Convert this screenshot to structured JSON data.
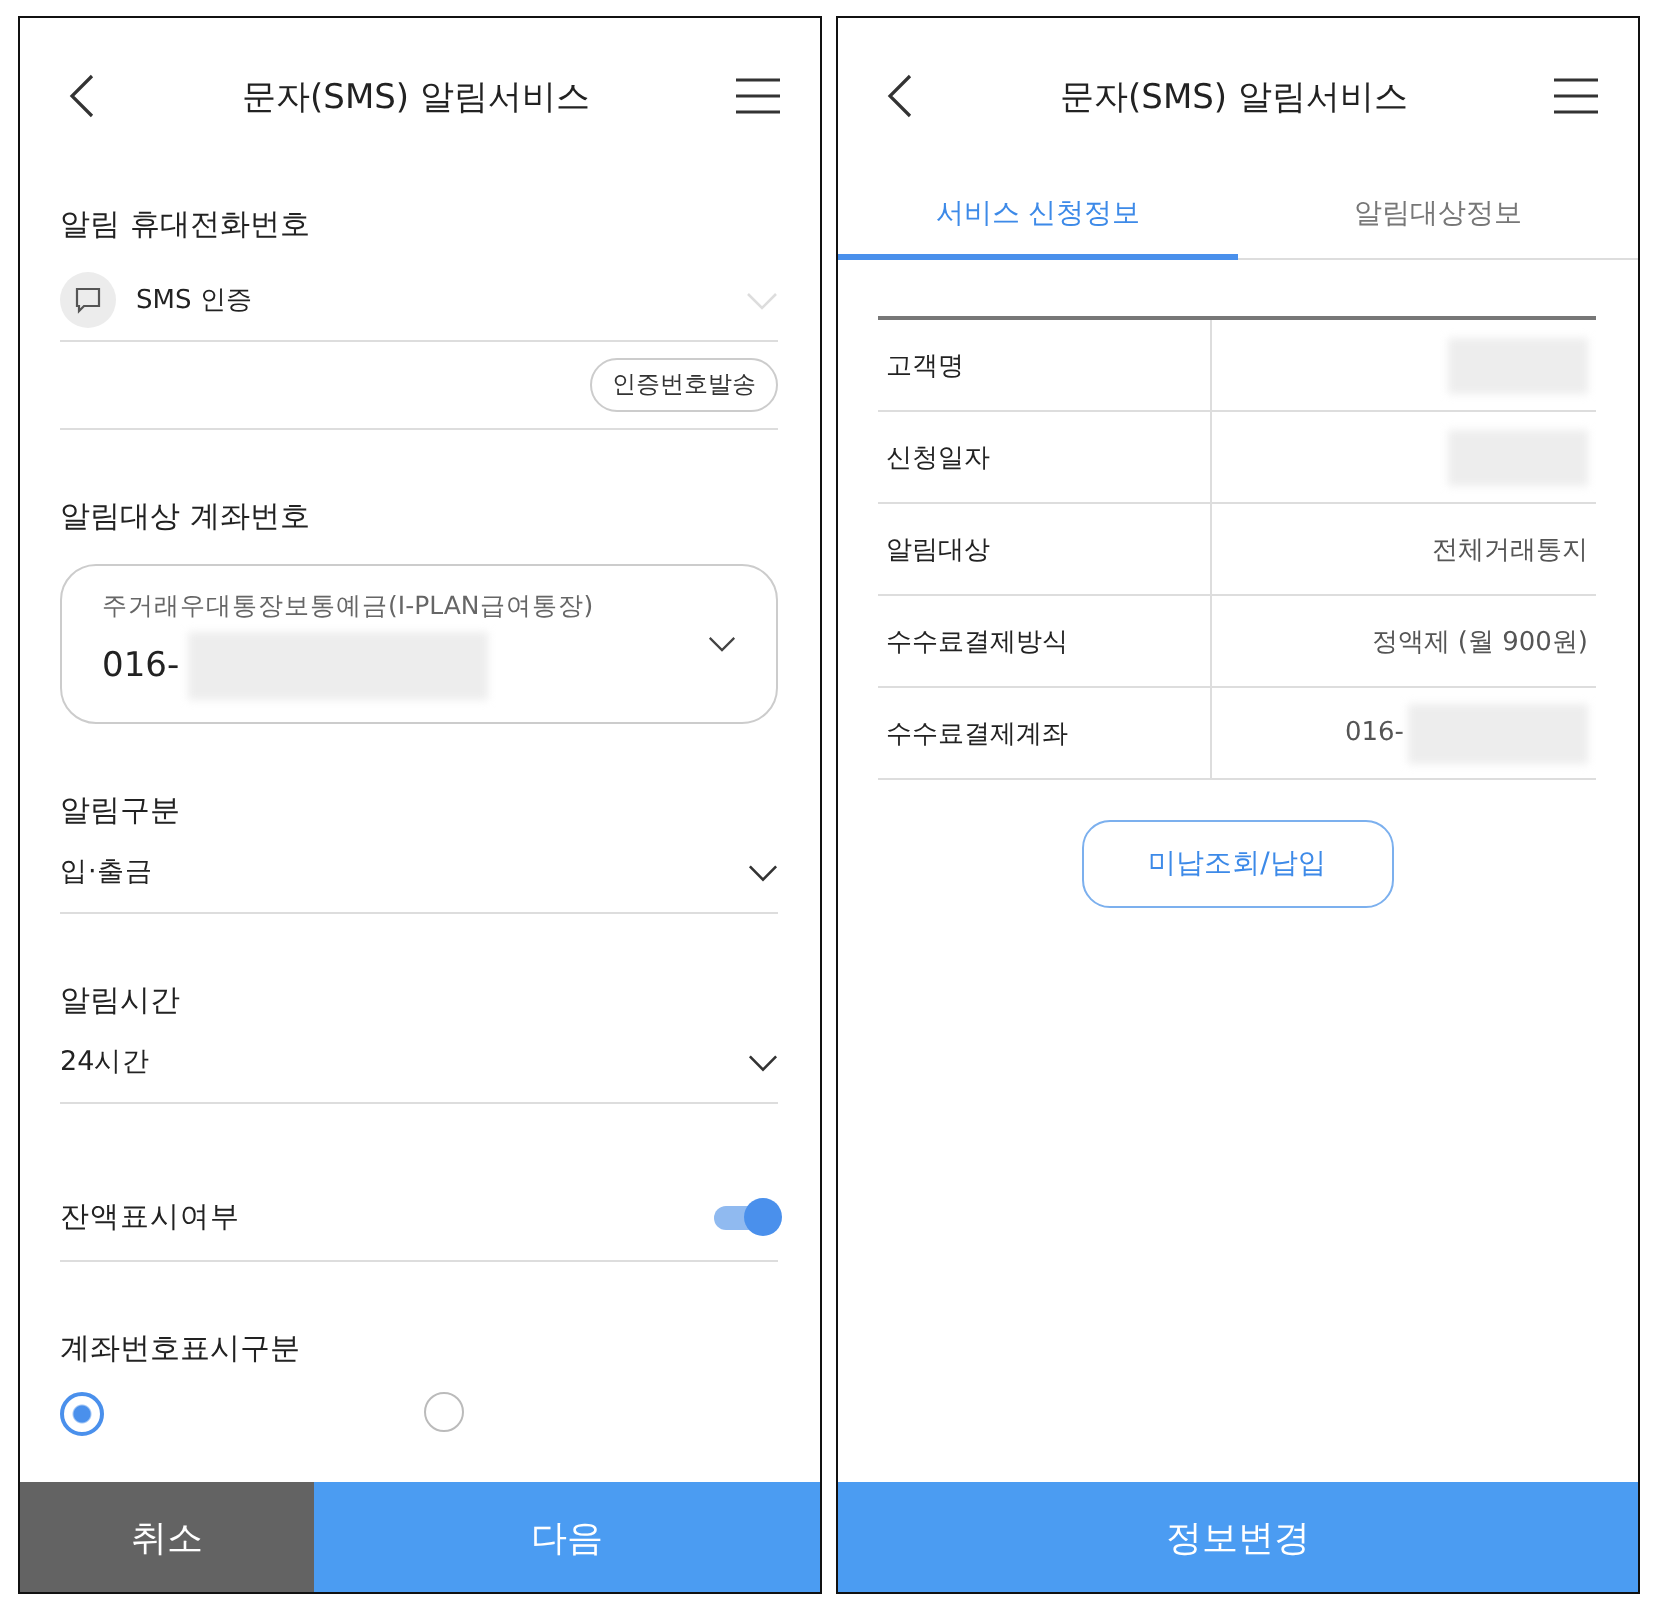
{
  "left_screen": {
    "header": {
      "title": "문자(SMS) 알림서비스"
    },
    "phone_section": {
      "label": "알림 휴대전화번호",
      "method": "SMS 인증",
      "send_button": "인증번호발송"
    },
    "account_section": {
      "label": "알림대상 계좌번호",
      "account_name": "주거래우대통장보통예금(I-PLAN급여통장)",
      "account_number": "016-",
      "masked": true
    },
    "selects": [
      {
        "label": "알림구분",
        "value": "입·출금"
      },
      {
        "label": "알림시간",
        "value": "24시간"
      }
    ],
    "balance_toggle": {
      "label": "잔액표시여부",
      "on": true
    },
    "display_section": {
      "label": "계좌번호표시구분",
      "options": [
        {
          "selected": true
        },
        {
          "selected": false
        }
      ]
    },
    "footer_buttons": [
      {
        "label": "취소",
        "kind": "secondary"
      },
      {
        "label": "다음",
        "kind": "primary"
      }
    ]
  },
  "right_screen": {
    "header": {
      "title": "문자(SMS) 알림서비스"
    },
    "tabs": [
      {
        "label": "서비스 신청정보",
        "selected": true
      },
      {
        "label": "알림대상정보",
        "selected": false
      }
    ],
    "table_rows": [
      {
        "label": "고객명",
        "masked": true
      },
      {
        "label": "신청일자",
        "masked": true
      },
      {
        "label": "알림대상",
        "value": "전체거래통지",
        "masked": false
      },
      {
        "label": "수수료결제방식",
        "value": "정액제 (월 900원)",
        "masked": false
      },
      {
        "label": "수수료결제계좌",
        "value": "016-",
        "masked": true
      }
    ],
    "unpaid_button": "미납조회/납입",
    "footer_button": "정보변경"
  }
}
